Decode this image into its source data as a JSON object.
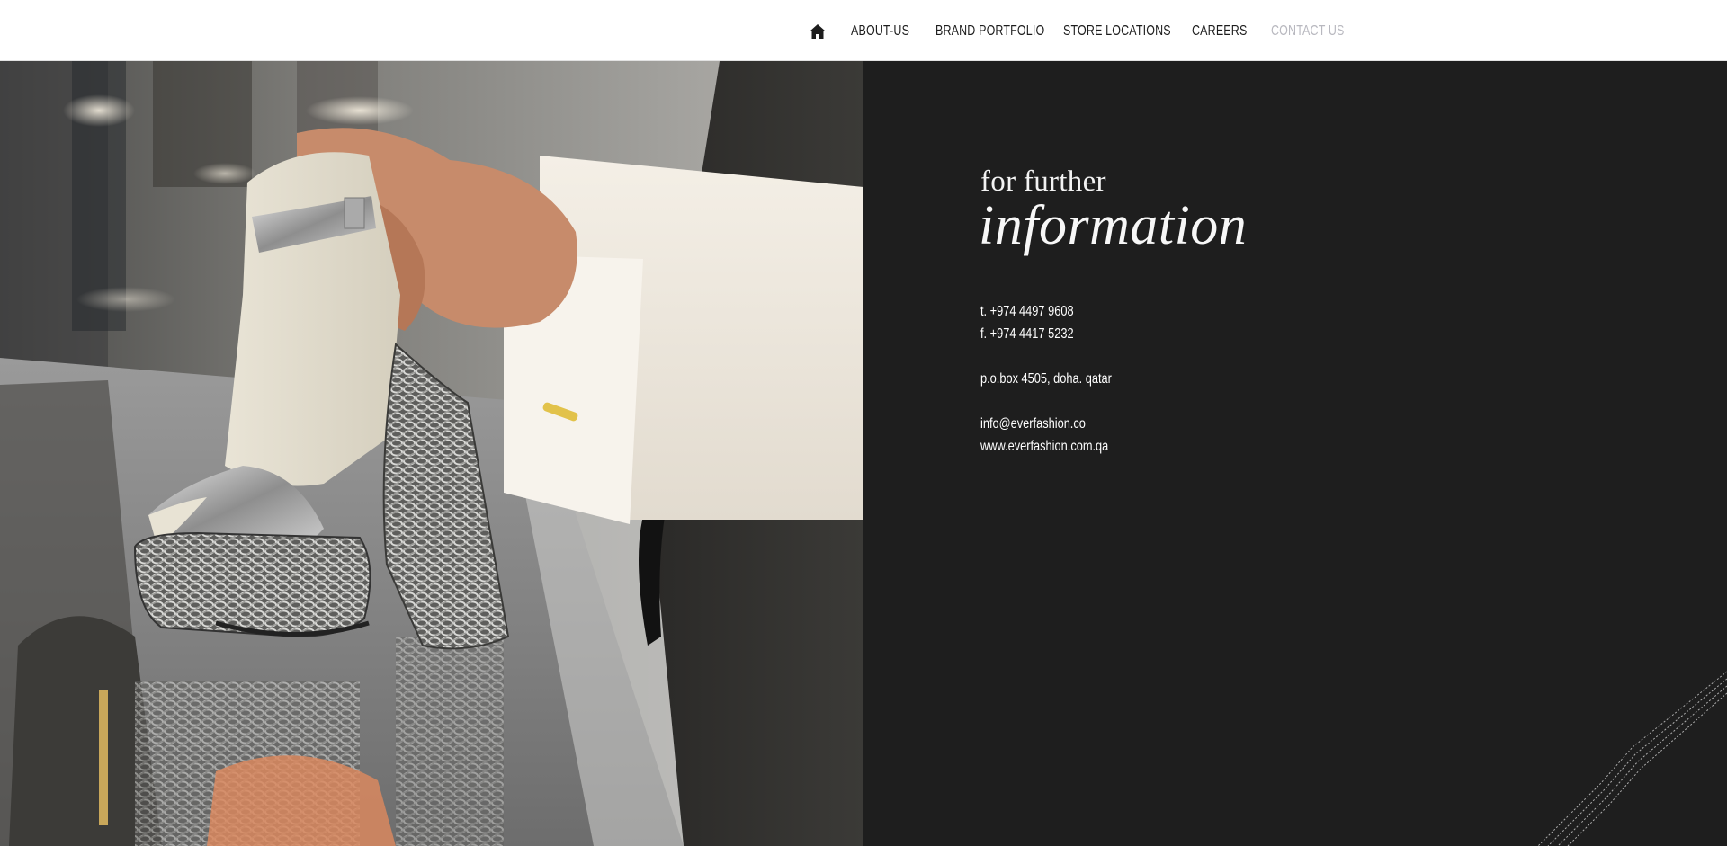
{
  "nav": {
    "home_icon": "home-icon",
    "items": [
      {
        "label": "ABOUT-US"
      },
      {
        "label": "BRAND PORTFOLIO"
      },
      {
        "label": "STORE LOCATIONS"
      },
      {
        "label": "CAREERS"
      },
      {
        "label": "CONTACT US",
        "active": true
      }
    ],
    "active_color": "#b8b8bf",
    "text_color": "#1d1d1d"
  },
  "contact": {
    "heading_small": "for further",
    "heading_large": "information",
    "phone": "t. +974 4497 9608",
    "fax": "f. +974 4417 5232",
    "address": "p.o.box 4505, doha. qatar",
    "email": "info@everfashion.co",
    "website": "www.everfashion.com.qa"
  },
  "colors": {
    "panel_bg": "#1e1e1e",
    "topbar_bg": "#ffffff",
    "text_light": "#ffffff"
  }
}
